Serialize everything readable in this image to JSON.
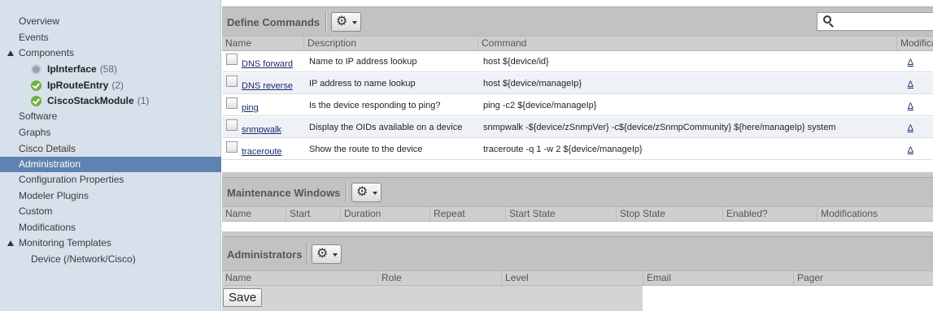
{
  "sidebar": {
    "items": [
      {
        "label": "Overview"
      },
      {
        "label": "Events"
      },
      {
        "label": "Components"
      },
      {
        "label": "IpInterface",
        "count": "(58)",
        "status": "gray"
      },
      {
        "label": "IpRouteEntry",
        "count": "(2)",
        "status": "green"
      },
      {
        "label": "CiscoStackModule",
        "count": "(1)",
        "status": "green"
      },
      {
        "label": "Software"
      },
      {
        "label": "Graphs"
      },
      {
        "label": "Cisco Details"
      },
      {
        "label": "Administration",
        "selected": true
      },
      {
        "label": "Configuration Properties"
      },
      {
        "label": "Modeler Plugins"
      },
      {
        "label": "Custom"
      },
      {
        "label": "Modifications"
      },
      {
        "label": "Monitoring Templates"
      },
      {
        "label": "Device (/Network/Cisco)"
      }
    ]
  },
  "commands": {
    "title": "Define Commands",
    "search_placeholder": "",
    "columns": [
      "Name",
      "Description",
      "Command",
      "Modifications"
    ],
    "rows": [
      {
        "name": "DNS forward",
        "description": "Name to IP address lookup",
        "command": "host ${device/id}",
        "mod": "Δ"
      },
      {
        "name": "DNS reverse",
        "description": "IP address to name lookup",
        "command": "host ${device/manageIp}",
        "mod": "Δ"
      },
      {
        "name": "ping",
        "description": "Is the device responding to ping?",
        "command": "ping -c2 ${device/manageIp}",
        "mod": "Δ"
      },
      {
        "name": "snmpwalk",
        "description": "Display the OIDs available on a device",
        "command": "snmpwalk -${device/zSnmpVer} -c${device/zSnmpCommunity} ${here/manageIp} system",
        "mod": "Δ"
      },
      {
        "name": "traceroute",
        "description": "Show the route to the device",
        "command": "traceroute -q 1 -w 2 ${device/manageIp}",
        "mod": "Δ"
      }
    ]
  },
  "maintenance": {
    "title": "Maintenance Windows",
    "columns": [
      "Name",
      "Start",
      "Duration",
      "Repeat",
      "Start State",
      "Stop State",
      "Enabled?",
      "Modifications"
    ]
  },
  "administrators": {
    "title": "Administrators",
    "columns": [
      "Name",
      "Role",
      "Level",
      "Email",
      "Pager"
    ]
  },
  "save_label": "Save",
  "icons": {
    "gear": "gear-icon",
    "search": "search-icon",
    "status_gray": "status-gray-icon",
    "status_green": "status-green-check-icon"
  },
  "colors": {
    "sidebar_bg": "#d6e1ec",
    "selected_bg": "#5e82b1",
    "panel_header": "#c2c2c2",
    "link": "#1a2a6c",
    "status_green": "#6db33f"
  }
}
